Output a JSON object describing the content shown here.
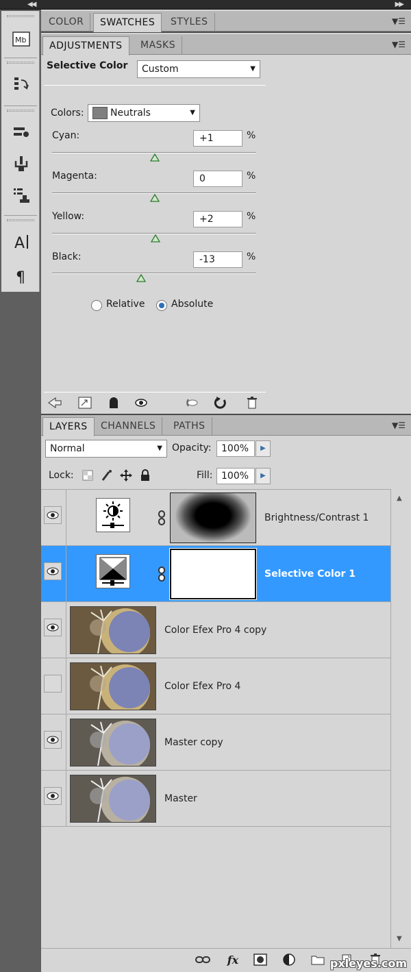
{
  "panel_tabs_top": [
    "COLOR",
    "SWATCHES",
    "STYLES"
  ],
  "adjustments": {
    "tabs": [
      "ADJUSTMENTS",
      "MASKS"
    ],
    "title": "Selective Color",
    "preset": "Custom",
    "colors_label": "Colors:",
    "colors_value": "Neutrals",
    "sliders": [
      {
        "label": "Cyan:",
        "value": "+1"
      },
      {
        "label": "Magenta:",
        "value": "0"
      },
      {
        "label": "Yellow:",
        "value": "+2"
      },
      {
        "label": "Black:",
        "value": "-13"
      }
    ],
    "percent": "%",
    "method_options": [
      "Relative",
      "Absolute"
    ],
    "method_selected": "Absolute"
  },
  "layers_panel": {
    "tabs": [
      "LAYERS",
      "CHANNELS",
      "PATHS"
    ],
    "blend_mode": "Normal",
    "opacity_label": "Opacity:",
    "opacity_value": "100%",
    "lock_label": "Lock:",
    "fill_label": "Fill:",
    "fill_value": "100%",
    "layers": [
      {
        "name": "Brightness/Contrast 1",
        "visible": true,
        "kind": "adjustment",
        "selected": false
      },
      {
        "name": "Selective Color 1",
        "visible": true,
        "kind": "adjustment",
        "selected": true
      },
      {
        "name": "Color Efex Pro 4 copy",
        "visible": true,
        "kind": "image",
        "selected": false
      },
      {
        "name": "Color Efex Pro 4",
        "visible": false,
        "kind": "image",
        "selected": false
      },
      {
        "name": "Master copy",
        "visible": true,
        "kind": "image",
        "selected": false
      },
      {
        "name": "Master",
        "visible": true,
        "kind": "image",
        "selected": false
      }
    ]
  },
  "toolstrip_icons": [
    "mini-bridge-icon",
    "history-icon",
    "brush-presets-icon",
    "clone-source-icon",
    "tool-presets-icon",
    "character-icon",
    "paragraph-icon"
  ],
  "watermark": "pxleyes.com",
  "colors": {
    "selection": "#3399ff",
    "panel": "#d6d6d6",
    "radio_on": "#2d6fb8"
  }
}
